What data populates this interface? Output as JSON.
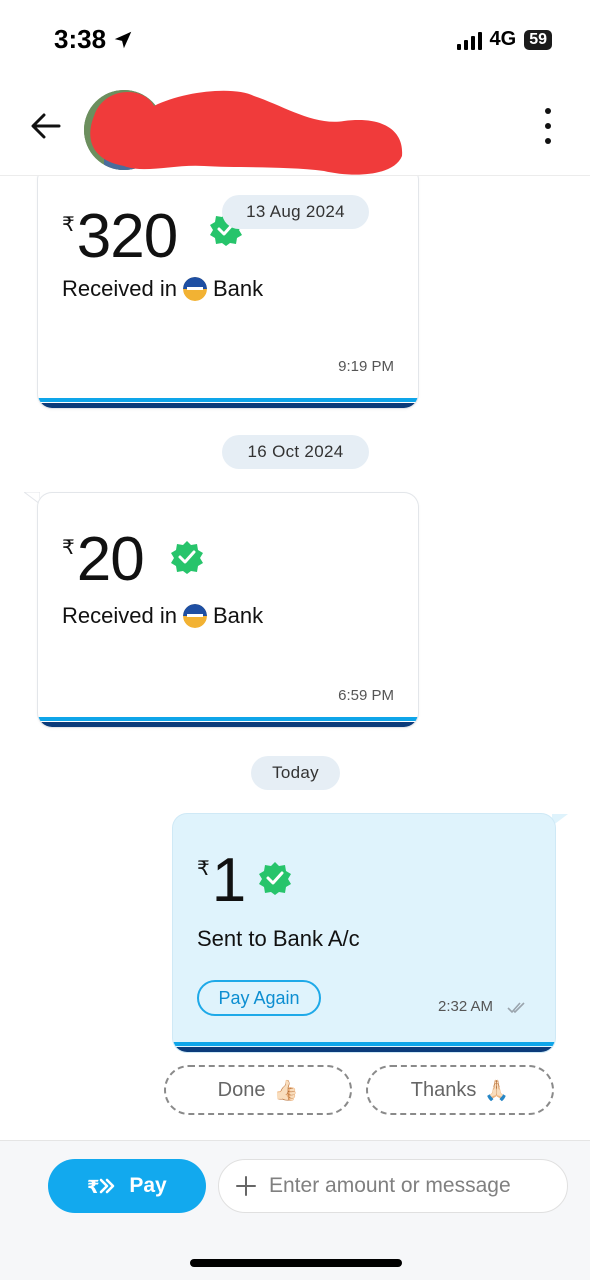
{
  "status_bar": {
    "time": "3:38",
    "network": "4G",
    "battery": "59"
  },
  "header": {
    "back_icon": "arrow-left-icon",
    "more_icon": "more-vertical-icon"
  },
  "messages": [
    {
      "type": "received",
      "currency": "₹",
      "amount": "320",
      "description_prefix": "Received in",
      "description_suffix": "Bank",
      "time": "9:19 PM",
      "date_label": "13 Aug 2024"
    },
    {
      "type": "received",
      "currency": "₹",
      "amount": "20",
      "description_prefix": "Received in",
      "description_suffix": "Bank",
      "time": "6:59 PM",
      "date_label": "16 Oct 2024"
    },
    {
      "type": "sent",
      "currency": "₹",
      "amount": "1",
      "description": "Sent to Bank A/c",
      "time": "2:32 AM",
      "action_label": "Pay Again",
      "date_label": "Today"
    }
  ],
  "quick_replies": [
    {
      "label": "Done",
      "emoji": "👍🏻"
    },
    {
      "label": "Thanks",
      "emoji": "🙏🏻"
    }
  ],
  "composer": {
    "pay_label": "Pay",
    "input_placeholder": "Enter amount or message",
    "plus_icon": "plus-icon"
  },
  "colors": {
    "accent": "#12a9ee",
    "verified_green": "#27c46b",
    "sent_bubble": "#dff3fc",
    "card_stripe_dark": "#0b3b7a"
  }
}
